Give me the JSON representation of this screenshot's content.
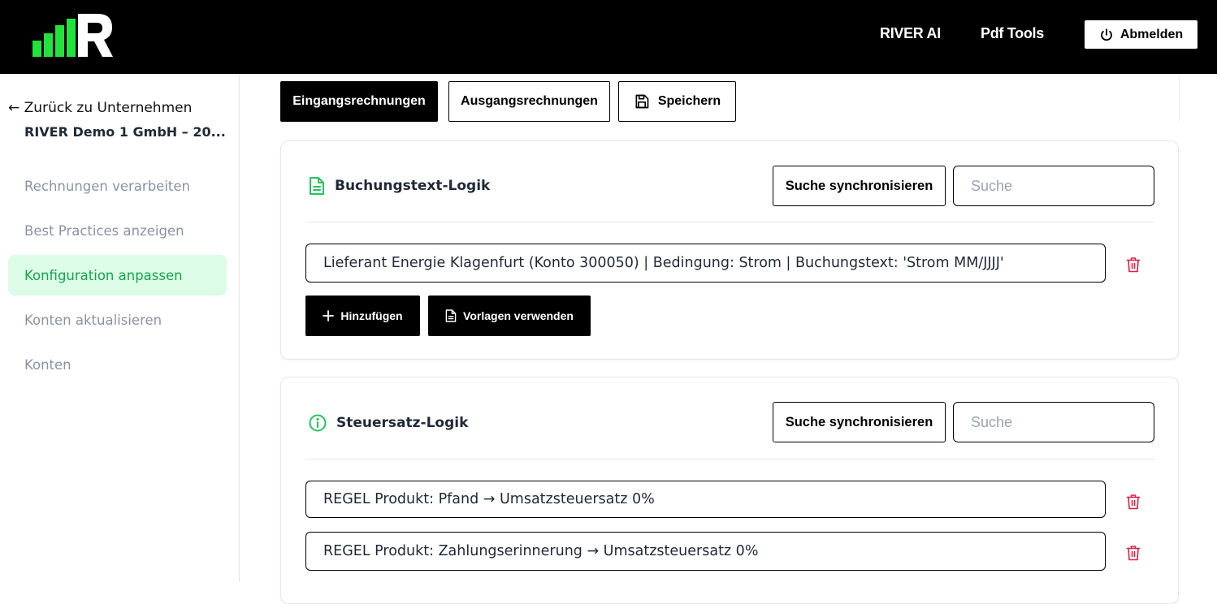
{
  "header": {
    "nav": [
      "RIVER AI",
      "Pdf Tools"
    ],
    "logout_label": "Abmelden"
  },
  "sidebar": {
    "back_label": "Zurück zu Unternehmen",
    "company": "RIVER Demo 1 GmbH – 20...",
    "items": [
      {
        "label": "Rechnungen verarbeiten",
        "active": false
      },
      {
        "label": "Best Practices anzeigen",
        "active": false
      },
      {
        "label": "Konfiguration anpassen",
        "active": true
      },
      {
        "label": "Konten aktualisieren",
        "active": false
      },
      {
        "label": "Konten",
        "active": false
      }
    ]
  },
  "toolbar": {
    "tab_incoming": "Eingangsrechnungen",
    "tab_outgoing": "Ausgangsrechnungen",
    "save_label": "Speichern"
  },
  "booking_card": {
    "title": "Buchungstext-Logik",
    "sync_label": "Suche synchronisieren",
    "search_placeholder": "Suche",
    "rules": [
      "Lieferant Energie Klagenfurt (Konto 300050) | Bedingung: Strom | Buchungstext: 'Strom MM/JJJJ'"
    ],
    "add_label": "Hinzufügen",
    "template_label": "Vorlagen verwenden"
  },
  "tax_card": {
    "title": "Steuersatz-Logik",
    "sync_label": "Suche synchronisieren",
    "search_placeholder": "Suche",
    "rules": [
      "REGEL Produkt: Pfand → Umsatzsteuersatz 0%",
      "REGEL Produkt: Zahlungserinnerung → Umsatzsteuersatz 0%"
    ]
  },
  "colors": {
    "accent_green": "#22c55e",
    "active_bg": "#dcfce7",
    "trash_red": "#e11d48"
  }
}
